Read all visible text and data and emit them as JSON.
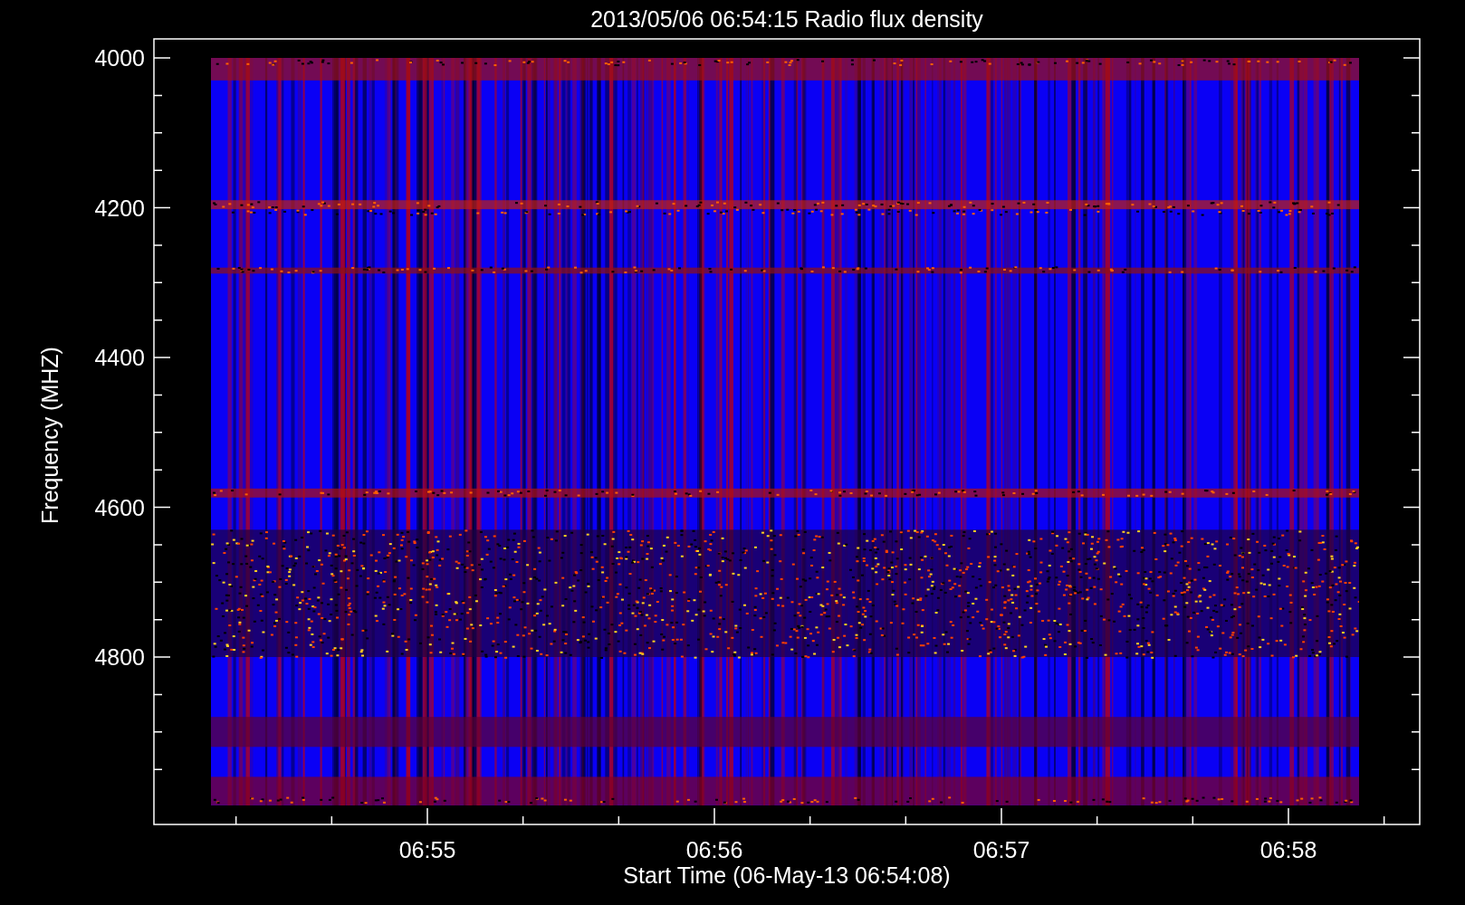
{
  "plot": {
    "title": "2013/05/06 06:54:15 Radio flux density",
    "ylabel": "Frequency (MHZ)",
    "xlabel": "Start Time (06-May-13 06:54:08)",
    "y_tick_labels": [
      "4000",
      "4200",
      "4400",
      "4600",
      "4800"
    ],
    "x_tick_labels": [
      "06:55",
      "06:56",
      "06:57",
      "06:58"
    ]
  }
}
